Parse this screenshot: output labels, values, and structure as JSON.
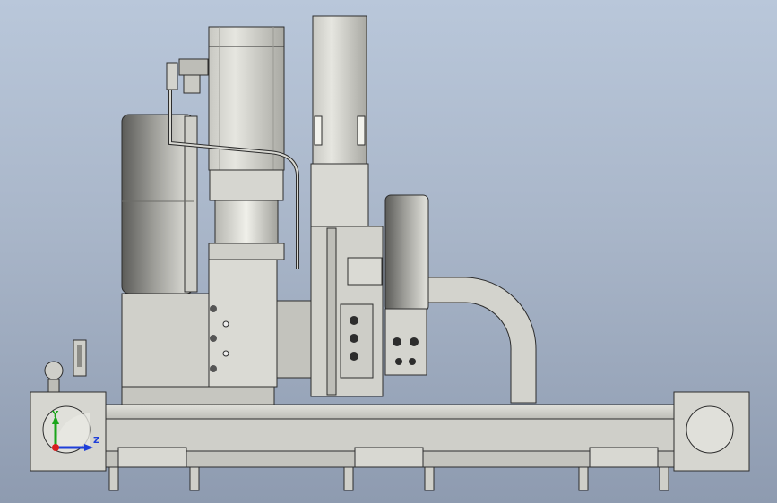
{
  "scene": {
    "colors": {
      "background_top": "#b9c7da",
      "background_bottom": "#8e9bb0",
      "metal_light": "#d9d9d3",
      "metal_mid": "#c7c7c0",
      "metal_dark": "#8f8f8a",
      "edge": "#2d2d2d",
      "cable": "#c9c9c2"
    }
  },
  "triad": {
    "y_label": "Y",
    "z_label": "Z",
    "y_color": "#1aa51a",
    "z_color": "#1f3fd9",
    "x_color": "#d81f1f"
  }
}
